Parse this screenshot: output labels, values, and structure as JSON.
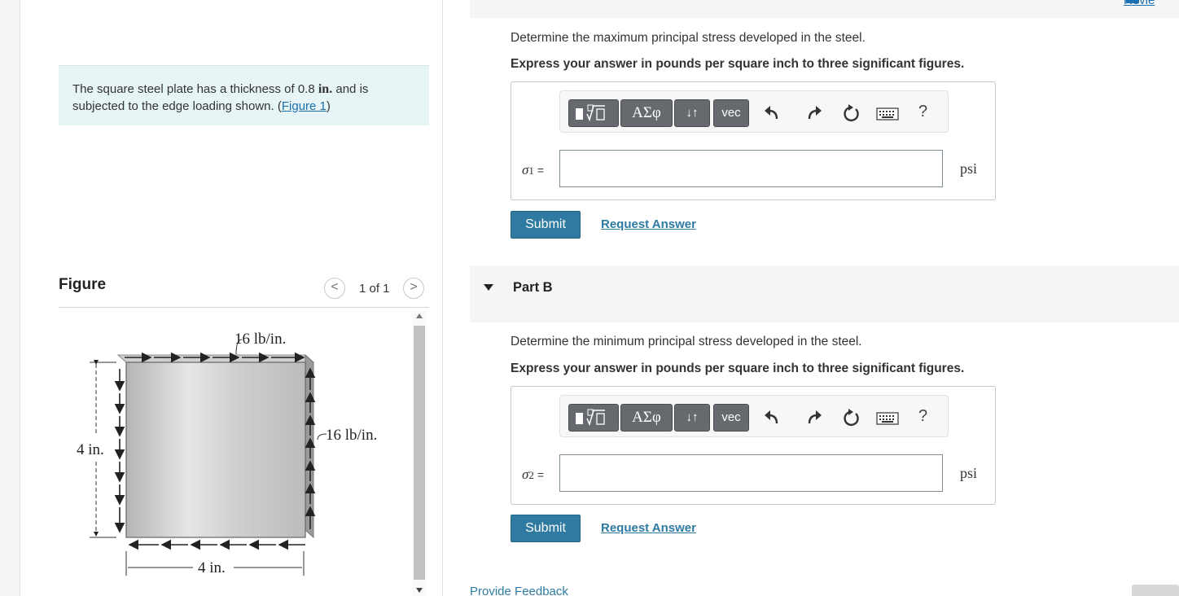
{
  "problem": {
    "text_before": "The square steel plate has a thickness of 0.8 ",
    "thickness_unit": "in.",
    "text_middle": " and is subjected to the edge loading shown. (",
    "figure_link": "Figure 1",
    "text_after": ")"
  },
  "figure_panel": {
    "title": "Figure",
    "pager_text": "1 of 1",
    "prev_glyph": "<",
    "next_glyph": ">",
    "labels": {
      "top_load": "16 lb/in.",
      "right_load": "16 lb/in.",
      "left_dim": "4 in.",
      "bottom_dim": "4 in."
    }
  },
  "top_link": "Revie",
  "toolbar": {
    "greek_label": "ΑΣφ",
    "arrows_label": "↓↑",
    "vec_label": "vec",
    "help_label": "?",
    "icons": [
      "templates-icon",
      "undo-icon",
      "redo-icon",
      "reset-icon",
      "keyboard-icon",
      "help-icon"
    ]
  },
  "part_a": {
    "question": "Determine the maximum principal stress developed in the steel.",
    "instruction": "Express your answer in pounds per square inch to three significant figures.",
    "variable": "σ",
    "subscript": "1",
    "equals": "=",
    "input_value": "",
    "unit": "psi",
    "submit_label": "Submit",
    "request_label": "Request Answer"
  },
  "part_b": {
    "title": "Part B",
    "question": "Determine the minimum principal stress developed in the steel.",
    "instruction": "Express your answer in pounds per square inch to three significant figures.",
    "variable": "σ",
    "subscript": "2",
    "equals": "=",
    "input_value": "",
    "unit": "psi",
    "submit_label": "Submit",
    "request_label": "Request Answer"
  },
  "footer": {
    "feedback_label": "Provide Feedback"
  },
  "colors": {
    "accent": "#2e7aa1",
    "problem_bg": "#e8f5f6",
    "toolbar_button": "#666a6e"
  }
}
